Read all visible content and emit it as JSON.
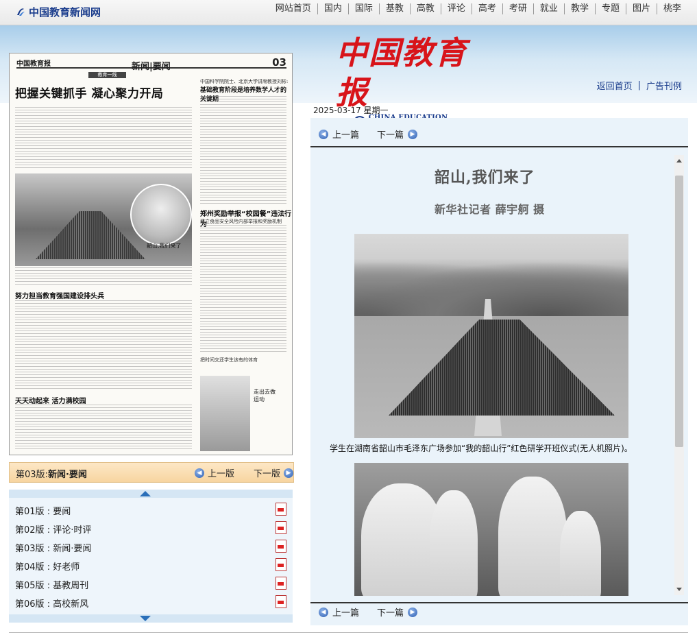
{
  "site": {
    "logo_text": "中国教育新闻网"
  },
  "topnav": [
    "网站首页",
    "国内",
    "国际",
    "基教",
    "高教",
    "评论",
    "高考",
    "考研",
    "就业",
    "教学",
    "专题",
    "图片",
    "桃李"
  ],
  "masthead": {
    "cn": "中国教育报",
    "en": "CHINA EDUCATION DAILY"
  },
  "header_links": {
    "home": "返回首页",
    "ads": "广告刊例",
    "separator": "|"
  },
  "date_line": "2025-03-17 星期一",
  "newspaper": {
    "brand": "中国教育报",
    "section": "新闻|要闻",
    "page_no": "03",
    "tag": "教育一线",
    "headline": "把握关键抓手 凝心聚力开局",
    "right_kicker": "中国科学院院士、北京大学讲席教授刘彬:",
    "right_head": "基础教育阶段是培养数学人才的关键期",
    "head2": "郑州奖励举报“校园餐”违法行为",
    "head2_sub": "建立食品安全风险内部举报和奖励机制",
    "head3": "努力担当教育强国建设排头兵",
    "head4": "天天动起来 活力满校园",
    "photo_caption": "韶山,我们来了",
    "small_caption": "走出去做运动",
    "small_caption2": "把时间交还学生该有的体育"
  },
  "pagebar": {
    "current_prefix": "第03版:",
    "current_name": "新闻·要闻",
    "prev": "上一版",
    "next": "下一版"
  },
  "pages": [
    {
      "no": "第01版",
      "sep": ":",
      "name": "要闻"
    },
    {
      "no": "第02版",
      "sep": ":",
      "name": "评论·时评"
    },
    {
      "no": "第03版",
      "sep": ":",
      "name": "新闻·要闻"
    },
    {
      "no": "第04版",
      "sep": ":",
      "name": "好老师"
    },
    {
      "no": "第05版",
      "sep": ":",
      "name": "基教周刊"
    },
    {
      "no": "第06版",
      "sep": ":",
      "name": "高校新风"
    }
  ],
  "article_nav": {
    "prev": "上一篇",
    "next": "下一篇"
  },
  "article": {
    "title": "韶山,我们来了",
    "byline": "新华社记者 薛宇舸 摄",
    "caption1": "学生在湖南省韶山市毛泽东广场参加“我的韶山行”红色研学开班仪式(无人机照片)。"
  },
  "colors": {
    "accent_blue": "#1a3c8c",
    "masthead_red": "#d8141a",
    "pagebar_orange": "#f7d5a0",
    "panel_blue": "#eaf3fa"
  }
}
